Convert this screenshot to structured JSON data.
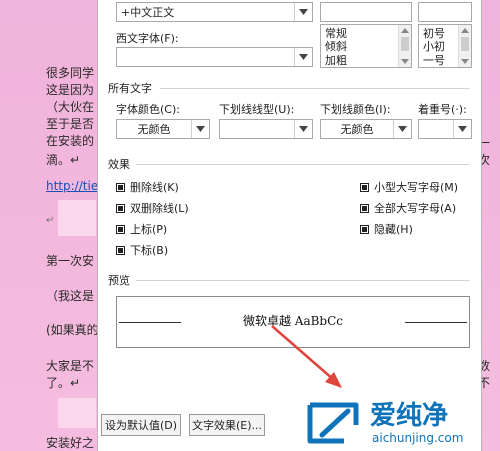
{
  "document": {
    "lines": [
      {
        "text": "很多同学"
      },
      {
        "text": "这是因为"
      },
      {
        "text": "（大伙在"
      },
      {
        "text": "至于是否"
      },
      {
        "text": "在安装的"
      },
      {
        "text": "滴。↵"
      },
      {
        "text": "http://tiel"
      },
      {
        "text": "第一次安"
      },
      {
        "text": "（我这是"
      },
      {
        "text": "(如果真的"
      },
      {
        "text": "大家是不"
      },
      {
        "text": "了。↵"
      },
      {
        "text": "安装好之"
      }
    ],
    "right_fragments": [
      "一次",
      "数不"
    ],
    "return_mark": "↵"
  },
  "dialog": {
    "top_font_value": "+中文正文",
    "western_font_label": "西文字体(F):",
    "style_list": [
      "常规",
      "倾斜",
      "加粗"
    ],
    "size_list": [
      "初号",
      "小初",
      "一号"
    ],
    "all_text_section": "所有文字",
    "font_color_label": "字体颜色(C):",
    "font_color_value": "无颜色",
    "underline_type_label": "下划线线型(U):",
    "underline_color_label": "下划线颜色(I):",
    "underline_color_value": "无颜色",
    "emphasis_label": "着重号(·):",
    "effects_section": "效果",
    "effects_left": [
      "删除线(K)",
      "双删除线(L)",
      "上标(P)",
      "下标(B)"
    ],
    "effects_right": [
      "小型大写字母(M)",
      "全部大写字母(A)",
      "隐藏(H)"
    ],
    "preview_section": "预览",
    "preview_text": "微软卓越  AaBbCc",
    "default_button": "设为默认值(D)",
    "text_effects_button": "文字效果(E)..."
  },
  "watermark": {
    "brand": "爱纯净",
    "url": "aichunjing.com"
  },
  "colors": {
    "arrow": "#e0443a",
    "watermark": "#0f73b9"
  }
}
